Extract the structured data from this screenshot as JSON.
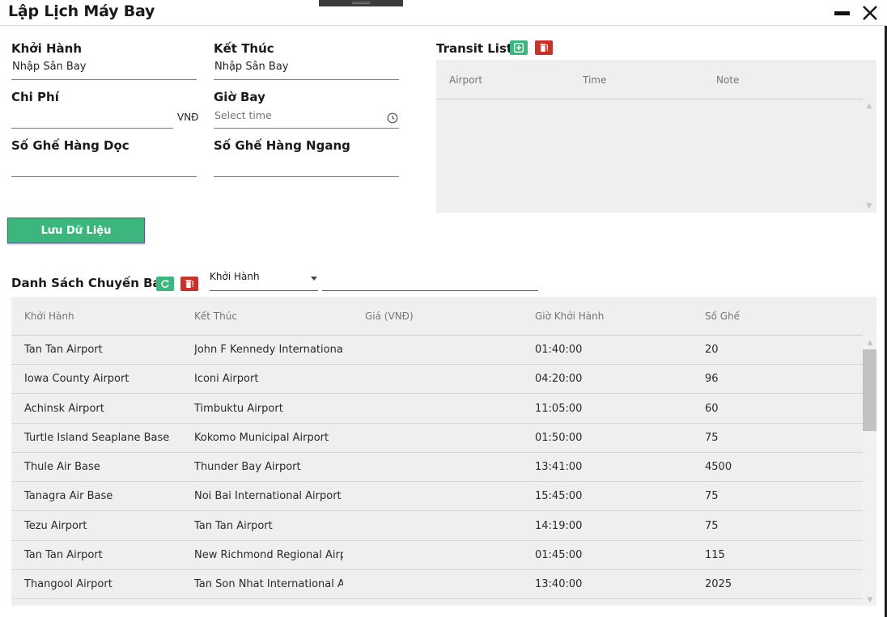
{
  "window": {
    "title": "Lập Lịch Máy Bay"
  },
  "form": {
    "departure": {
      "label": "Khởi Hành",
      "value": "Nhập Sân Bay"
    },
    "arrival": {
      "label": "Kết Thúc",
      "value": "Nhập Sân Bay"
    },
    "cost": {
      "label": "Chi Phí",
      "value": "",
      "unit": "VNĐ"
    },
    "flight_time": {
      "label": "Giờ Bay",
      "placeholder": "Select time"
    },
    "seat_rows": {
      "label": "Số Ghế Hàng Dọc",
      "value": ""
    },
    "seat_cols": {
      "label": "Số Ghế Hàng Ngang",
      "value": ""
    },
    "save_label": "Lưu Dữ Liệu"
  },
  "transit": {
    "title": "Transit List",
    "columns": [
      "Airport",
      "Time",
      "Note"
    ],
    "rows": []
  },
  "flights": {
    "title": "Danh Sách Chuyến Bay",
    "filter_value": "Khởi Hành",
    "search_value": "",
    "columns": [
      "Khởi Hành",
      "Kết Thúc",
      "Giá (VNĐ)",
      "Giờ Khởi Hành",
      "Số Ghế"
    ],
    "rows": [
      [
        "Tan Tan Airport",
        "John F Kennedy International Air",
        "",
        "01:40:00",
        "20"
      ],
      [
        "Iowa County Airport",
        "Iconi Airport",
        "",
        "04:20:00",
        "96"
      ],
      [
        "Achinsk Airport",
        "Timbuktu Airport",
        "",
        "11:05:00",
        "60"
      ],
      [
        "Turtle Island Seaplane Base",
        "Kokomo Municipal Airport",
        "",
        "01:50:00",
        "75"
      ],
      [
        "Thule Air Base",
        "Thunder Bay Airport",
        "",
        "13:41:00",
        "4500"
      ],
      [
        "Tanagra Air Base",
        "Noi Bai International Airport",
        "",
        "15:45:00",
        "75"
      ],
      [
        "Tezu Airport",
        "Tan Tan Airport",
        "",
        "14:19:00",
        "75"
      ],
      [
        "Tan Tan Airport",
        "New Richmond Regional Airport",
        "",
        "01:45:00",
        "115"
      ],
      [
        "Thangool Airport",
        "Tan Son Nhat International Airpo",
        "",
        "13:40:00",
        "2025"
      ]
    ]
  },
  "icons": {
    "add": "plus-square-icon",
    "delete": "trash-icon",
    "refresh": "refresh-icon",
    "clock": "clock-icon"
  },
  "colors": {
    "accent_green": "#3bb77e",
    "danger_red": "#c9322b",
    "panel_bg": "#efefef"
  }
}
